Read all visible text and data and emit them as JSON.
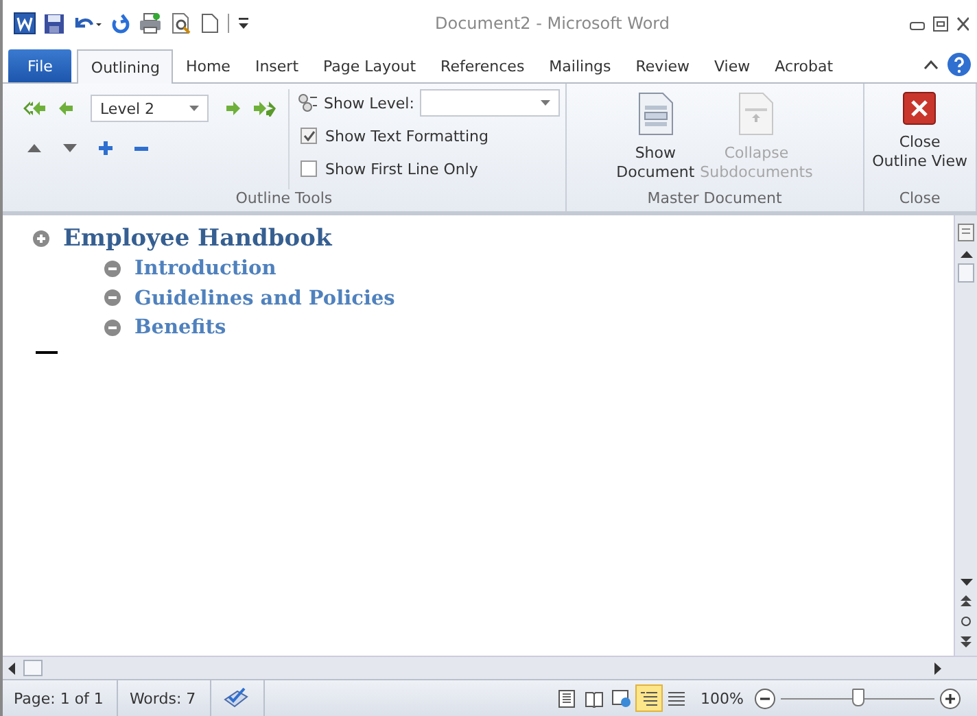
{
  "window": {
    "title": "Document2 - Microsoft Word"
  },
  "tabs": [
    {
      "label": "File",
      "kind": "file",
      "selected": false
    },
    {
      "label": "Outlining",
      "kind": "tab",
      "selected": true
    },
    {
      "label": "Home",
      "kind": "tab",
      "selected": false
    },
    {
      "label": "Insert",
      "kind": "tab",
      "selected": false
    },
    {
      "label": "Page Layout",
      "kind": "tab",
      "selected": false
    },
    {
      "label": "References",
      "kind": "tab",
      "selected": false
    },
    {
      "label": "Mailings",
      "kind": "tab",
      "selected": false
    },
    {
      "label": "Review",
      "kind": "tab",
      "selected": false
    },
    {
      "label": "View",
      "kind": "tab",
      "selected": false
    },
    {
      "label": "Acrobat",
      "kind": "tab",
      "selected": false
    }
  ],
  "ribbon": {
    "outline_tools": {
      "label": "Outline Tools",
      "level": "Level 2",
      "show_level": {
        "label": "Show Level:"
      },
      "checkboxes": [
        {
          "label": "Show Text Formatting",
          "checked": true
        },
        {
          "label": "Show First Line Only",
          "checked": false
        }
      ]
    },
    "master_document": {
      "label": "Master Document",
      "buttons": [
        {
          "lines": [
            "Show",
            "Document"
          ],
          "kind": "show",
          "disabled": false
        },
        {
          "lines": [
            "Collapse",
            "Subdocuments"
          ],
          "kind": "collapse",
          "disabled": true
        }
      ]
    },
    "close": {
      "label": "Close",
      "button": {
        "lines": [
          "Close",
          "Outline View"
        ]
      }
    }
  },
  "outline": [
    {
      "text": "Employee Handbook",
      "children": [
        {
          "text": "Introduction"
        },
        {
          "text": "Guidelines and Policies"
        },
        {
          "text": "Benefits"
        }
      ]
    }
  ],
  "status_bar": {
    "page": "Page: 1 of 1",
    "words": "Words: 7",
    "views": [
      {
        "kind": "print",
        "selected": false
      },
      {
        "kind": "reading",
        "selected": false
      },
      {
        "kind": "web",
        "selected": false
      },
      {
        "kind": "outline",
        "selected": true
      },
      {
        "kind": "draft",
        "selected": false
      }
    ],
    "zoom": "100%",
    "zoom_slider": {
      "level": 0.5
    }
  }
}
